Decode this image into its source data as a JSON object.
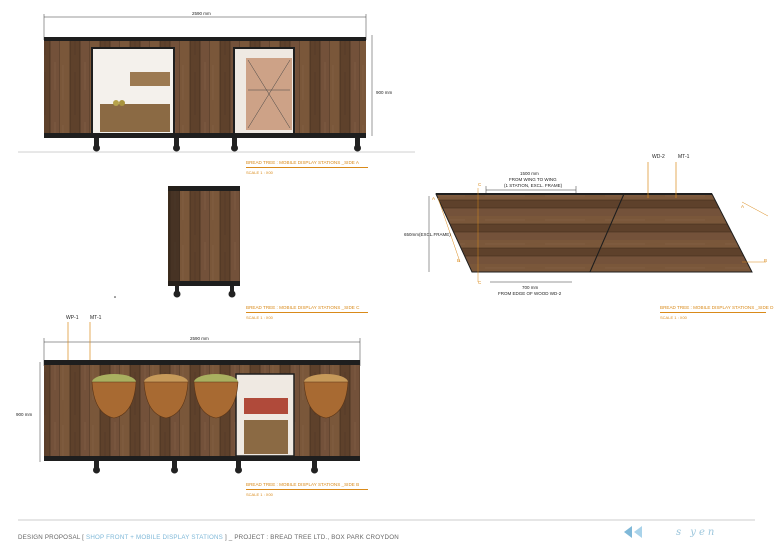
{
  "side_a": {
    "dimension_width": "2590 mm",
    "dimension_height": "900 mm",
    "caption": "BREAD TREE : MOBILE DISPLAY STATIONS _SIDE A",
    "scale": "SCALE 1 : X00"
  },
  "side_c": {
    "caption": "BREAD TREE : MOBILE DISPLAY STATIONS _SIDE C",
    "scale": "SCALE 1 : X00"
  },
  "side_b": {
    "dimension_width": "2590 mm",
    "dimension_height": "900 mm",
    "tag_wp": "WP-1",
    "tag_mt": "MT-1",
    "caption": "BREAD TREE : MOBILE DISPLAY STATIONS _SIDE B",
    "scale": "SCALE 1 : X00"
  },
  "plan": {
    "tag_wd": "WD-2",
    "tag_mt": "MT-1",
    "dim_top_value": "1500 mm",
    "dim_top_line1": "FROM WING TO WING",
    "dim_top_line2": "(1 STATION, EXCL. FRAME)",
    "dim_left": "650mm(EXCL.FRAME)",
    "dim_bottom_value": "700 mm",
    "dim_bottom_note": "FROM EDGE OF WOOD WD-2",
    "marker_a": "A",
    "marker_b": "B",
    "marker_c": "C",
    "caption": "BREAD TREE : MOBILE DISPLAY STATIONS _SIDE D",
    "scale": "SCALE 1 : X00"
  },
  "footer": {
    "prefix": "DESIGN PROPOSAL [",
    "highlight": "SHOP FRONT + MOBILE DISPLAY STATIONS",
    "suffix": "] _ PROJECT : BREAD TREE LTD., BOX PARK CROYDON",
    "logo_text": "s yen"
  },
  "colors": {
    "wood": "#6b4a32",
    "metal": "#1e1e1e",
    "caption": "#d98a1a",
    "footer_accent": "#7fb8d8"
  }
}
